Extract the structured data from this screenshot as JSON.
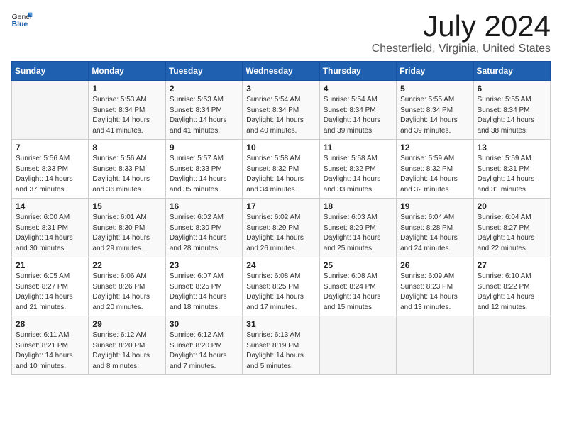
{
  "logo": {
    "general": "General",
    "blue": "Blue"
  },
  "title": "July 2024",
  "location": "Chesterfield, Virginia, United States",
  "headers": [
    "Sunday",
    "Monday",
    "Tuesday",
    "Wednesday",
    "Thursday",
    "Friday",
    "Saturday"
  ],
  "weeks": [
    [
      {
        "day": "",
        "info": ""
      },
      {
        "day": "1",
        "info": "Sunrise: 5:53 AM\nSunset: 8:34 PM\nDaylight: 14 hours\nand 41 minutes."
      },
      {
        "day": "2",
        "info": "Sunrise: 5:53 AM\nSunset: 8:34 PM\nDaylight: 14 hours\nand 41 minutes."
      },
      {
        "day": "3",
        "info": "Sunrise: 5:54 AM\nSunset: 8:34 PM\nDaylight: 14 hours\nand 40 minutes."
      },
      {
        "day": "4",
        "info": "Sunrise: 5:54 AM\nSunset: 8:34 PM\nDaylight: 14 hours\nand 39 minutes."
      },
      {
        "day": "5",
        "info": "Sunrise: 5:55 AM\nSunset: 8:34 PM\nDaylight: 14 hours\nand 39 minutes."
      },
      {
        "day": "6",
        "info": "Sunrise: 5:55 AM\nSunset: 8:34 PM\nDaylight: 14 hours\nand 38 minutes."
      }
    ],
    [
      {
        "day": "7",
        "info": "Sunrise: 5:56 AM\nSunset: 8:33 PM\nDaylight: 14 hours\nand 37 minutes."
      },
      {
        "day": "8",
        "info": "Sunrise: 5:56 AM\nSunset: 8:33 PM\nDaylight: 14 hours\nand 36 minutes."
      },
      {
        "day": "9",
        "info": "Sunrise: 5:57 AM\nSunset: 8:33 PM\nDaylight: 14 hours\nand 35 minutes."
      },
      {
        "day": "10",
        "info": "Sunrise: 5:58 AM\nSunset: 8:32 PM\nDaylight: 14 hours\nand 34 minutes."
      },
      {
        "day": "11",
        "info": "Sunrise: 5:58 AM\nSunset: 8:32 PM\nDaylight: 14 hours\nand 33 minutes."
      },
      {
        "day": "12",
        "info": "Sunrise: 5:59 AM\nSunset: 8:32 PM\nDaylight: 14 hours\nand 32 minutes."
      },
      {
        "day": "13",
        "info": "Sunrise: 5:59 AM\nSunset: 8:31 PM\nDaylight: 14 hours\nand 31 minutes."
      }
    ],
    [
      {
        "day": "14",
        "info": "Sunrise: 6:00 AM\nSunset: 8:31 PM\nDaylight: 14 hours\nand 30 minutes."
      },
      {
        "day": "15",
        "info": "Sunrise: 6:01 AM\nSunset: 8:30 PM\nDaylight: 14 hours\nand 29 minutes."
      },
      {
        "day": "16",
        "info": "Sunrise: 6:02 AM\nSunset: 8:30 PM\nDaylight: 14 hours\nand 28 minutes."
      },
      {
        "day": "17",
        "info": "Sunrise: 6:02 AM\nSunset: 8:29 PM\nDaylight: 14 hours\nand 26 minutes."
      },
      {
        "day": "18",
        "info": "Sunrise: 6:03 AM\nSunset: 8:29 PM\nDaylight: 14 hours\nand 25 minutes."
      },
      {
        "day": "19",
        "info": "Sunrise: 6:04 AM\nSunset: 8:28 PM\nDaylight: 14 hours\nand 24 minutes."
      },
      {
        "day": "20",
        "info": "Sunrise: 6:04 AM\nSunset: 8:27 PM\nDaylight: 14 hours\nand 22 minutes."
      }
    ],
    [
      {
        "day": "21",
        "info": "Sunrise: 6:05 AM\nSunset: 8:27 PM\nDaylight: 14 hours\nand 21 minutes."
      },
      {
        "day": "22",
        "info": "Sunrise: 6:06 AM\nSunset: 8:26 PM\nDaylight: 14 hours\nand 20 minutes."
      },
      {
        "day": "23",
        "info": "Sunrise: 6:07 AM\nSunset: 8:25 PM\nDaylight: 14 hours\nand 18 minutes."
      },
      {
        "day": "24",
        "info": "Sunrise: 6:08 AM\nSunset: 8:25 PM\nDaylight: 14 hours\nand 17 minutes."
      },
      {
        "day": "25",
        "info": "Sunrise: 6:08 AM\nSunset: 8:24 PM\nDaylight: 14 hours\nand 15 minutes."
      },
      {
        "day": "26",
        "info": "Sunrise: 6:09 AM\nSunset: 8:23 PM\nDaylight: 14 hours\nand 13 minutes."
      },
      {
        "day": "27",
        "info": "Sunrise: 6:10 AM\nSunset: 8:22 PM\nDaylight: 14 hours\nand 12 minutes."
      }
    ],
    [
      {
        "day": "28",
        "info": "Sunrise: 6:11 AM\nSunset: 8:21 PM\nDaylight: 14 hours\nand 10 minutes."
      },
      {
        "day": "29",
        "info": "Sunrise: 6:12 AM\nSunset: 8:20 PM\nDaylight: 14 hours\nand 8 minutes."
      },
      {
        "day": "30",
        "info": "Sunrise: 6:12 AM\nSunset: 8:20 PM\nDaylight: 14 hours\nand 7 minutes."
      },
      {
        "day": "31",
        "info": "Sunrise: 6:13 AM\nSunset: 8:19 PM\nDaylight: 14 hours\nand 5 minutes."
      },
      {
        "day": "",
        "info": ""
      },
      {
        "day": "",
        "info": ""
      },
      {
        "day": "",
        "info": ""
      }
    ]
  ]
}
